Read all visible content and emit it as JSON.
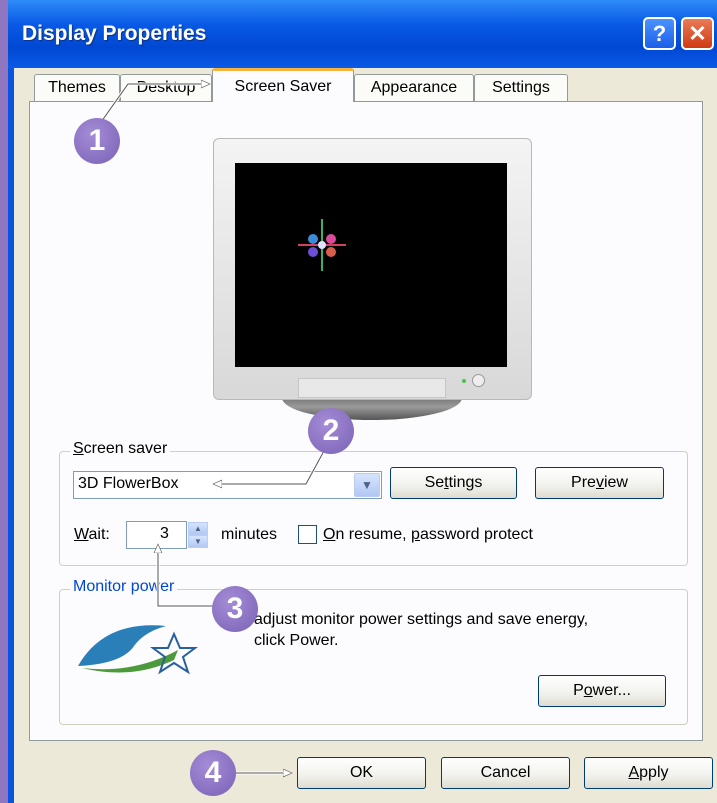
{
  "window": {
    "title": "Display Properties",
    "help_label": "?",
    "close_label": "✕"
  },
  "tabs": [
    {
      "label": "Themes"
    },
    {
      "label": "Desktop"
    },
    {
      "label": "Screen Saver",
      "selected": true
    },
    {
      "label": "Appearance"
    },
    {
      "label": "Settings"
    }
  ],
  "screen_saver": {
    "group_label_pre": "",
    "group_label_ul": "S",
    "group_label_post": "creen saver",
    "selected": "3D FlowerBox",
    "settings_pre": "Se",
    "settings_ul": "t",
    "settings_post": "tings",
    "preview_pre": "Pre",
    "preview_ul": "v",
    "preview_post": "iew",
    "wait_ul": "W",
    "wait_post": "ait:",
    "wait_value": "3",
    "minutes_label": "minutes",
    "resume_ul": "O",
    "resume_mid": "n resume, ",
    "resume_ul2": "p",
    "resume_post": "assword protect",
    "resume_checked": false
  },
  "monitor_power": {
    "group_label": "Monitor power",
    "description_line1": "adjust monitor power settings and save energy,",
    "description_line2": "click Power.",
    "power_pre": "P",
    "power_ul": "o",
    "power_post": "wer..."
  },
  "footer": {
    "ok_label": "OK",
    "cancel_label": "Cancel",
    "apply_ul": "A",
    "apply_post": "pply"
  },
  "callouts": [
    "1",
    "2",
    "3",
    "4"
  ],
  "icons": {
    "help": "help-icon",
    "close": "close-icon",
    "dropdown": "chevron-down-icon",
    "spin_up": "chevron-up-icon",
    "spin_down": "chevron-down-icon",
    "energy": "energy-star-logo"
  },
  "colors": {
    "title_bar": "#0a5ae6",
    "tab_highlight": "#f3b33d",
    "callout": "#8a71c5",
    "dialog": "#ece9d8"
  }
}
